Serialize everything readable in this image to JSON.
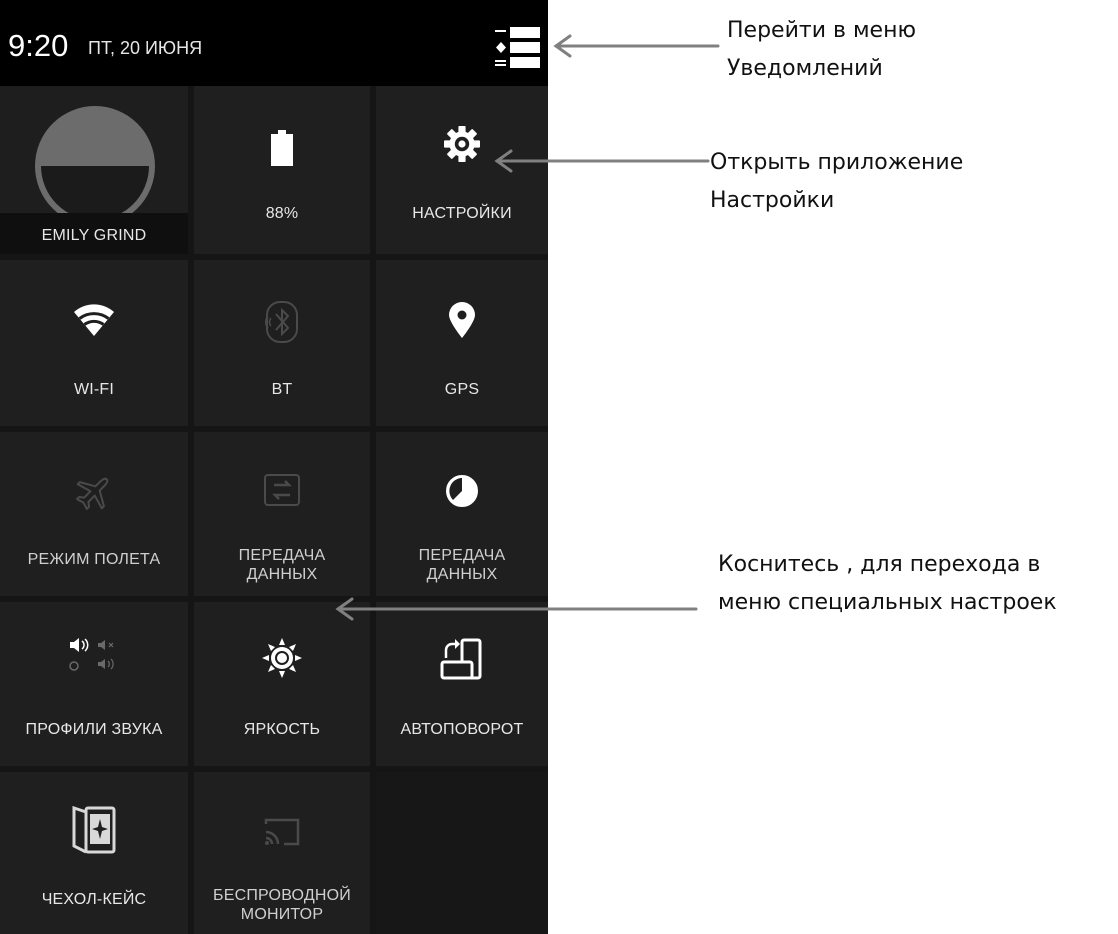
{
  "status_bar": {
    "time": "9:20",
    "date": "ПТ, 20 ИЮНЯ",
    "notifications_menu_icon": "notifications-list-icon"
  },
  "tiles": {
    "user": {
      "label": "EMILY GRIND",
      "icon": "avatar"
    },
    "battery": {
      "label": "88%",
      "icon": "battery-icon"
    },
    "settings": {
      "label": "НАСТРОЙКИ",
      "icon": "gear-icon"
    },
    "wifi": {
      "label": "WI-FI",
      "icon": "wifi-icon"
    },
    "bt": {
      "label": "BT",
      "icon": "bluetooth-icon"
    },
    "gps": {
      "label": "GPS",
      "icon": "location-pin-icon"
    },
    "airplane": {
      "label": "РЕЖИМ ПОЛЕТА",
      "icon": "airplane-icon"
    },
    "data_transfer": {
      "label_line1": "ПЕРЕДАЧА",
      "label_line2": "ДАННЫХ",
      "icon": "data-transfer-icon"
    },
    "data_usage": {
      "label_line1": "ПЕРЕДАЧА",
      "label_line2": "ДАННЫХ",
      "icon": "data-usage-icon"
    },
    "sound_profiles": {
      "label": "ПРОФИЛИ ЗВУКА",
      "icon": "sound-profiles-icon"
    },
    "brightness": {
      "label": "ЯРКОСТЬ",
      "icon": "brightness-icon"
    },
    "autorotate": {
      "label": "АВТОПОВОРОТ",
      "icon": "autorotate-icon"
    },
    "cover_case": {
      "label": "ЧЕХОЛ-КЕЙС",
      "icon": "cover-case-icon"
    },
    "wireless_display": {
      "label_line1": "БЕСПРОВОДНОЙ",
      "label_line2": "МОНИТОР",
      "icon": "cast-icon"
    }
  },
  "annotations": {
    "notifications": {
      "line1": "Перейти в меню",
      "line2": "Уведомлений"
    },
    "settings": {
      "line1": "Открыть приложение",
      "line2": "Настройки"
    },
    "special": {
      "line1": "Коснитесь , для перехода в",
      "line2": "меню специальных настроек"
    }
  },
  "colors": {
    "panel_background": "#151515",
    "tile_background": "#1f1f1f",
    "status_bar": "#000000",
    "arrow": "#808080",
    "active_icon": "#ffffff",
    "inactive_icon": "#4a4a4a"
  }
}
